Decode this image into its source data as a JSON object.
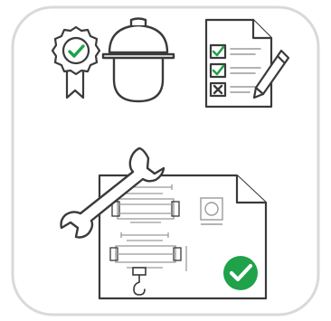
{
  "card": {
    "background": "#ffffff",
    "border_color": "#d9d9d9"
  },
  "colors": {
    "outline": "#3a3a3a",
    "check_green": "#1fa24a",
    "blueprint_line": "#9a9a9a",
    "paper": "#ffffff"
  },
  "icons": [
    "certified-badge-icon",
    "hard-hat-worker-icon",
    "inspection-checklist-icon",
    "pencil-icon",
    "wrench-icon",
    "technical-drawing-icon",
    "approved-check-icon"
  ],
  "checklist": {
    "items": [
      {
        "state": "checked"
      },
      {
        "state": "checked"
      },
      {
        "state": "crossed"
      }
    ]
  }
}
